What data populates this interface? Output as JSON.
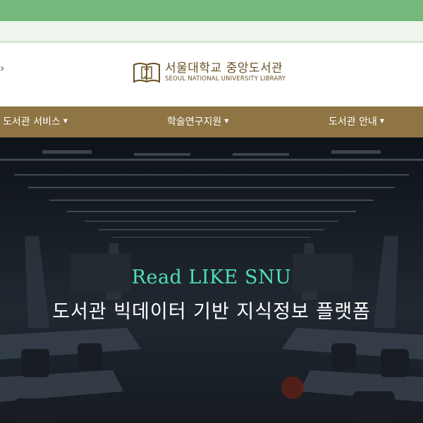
{
  "colors": {
    "top_bar": "#74b97b",
    "nav_bar": "#8f7444",
    "logo": "#6b5126",
    "hero_title": "#4fe0b2",
    "hero_subtitle": "#ffffff"
  },
  "header": {
    "logo_icon": "book-emblem-icon",
    "logo_korean": "서울대학교 중앙도서관",
    "logo_english": "SEOUL NATIONAL UNIVERSITY LIBRARY"
  },
  "nav": {
    "items": [
      {
        "label": "도서관 서비스",
        "icon": "caret-down-icon"
      },
      {
        "label": "학술연구지원",
        "icon": "caret-down-icon"
      },
      {
        "label": "도서관 안내",
        "icon": "caret-down-icon"
      }
    ]
  },
  "hero": {
    "title": "Read LIKE SNU",
    "subtitle": "도서관 빅데이터 기반 지식정보 플랫폼"
  }
}
